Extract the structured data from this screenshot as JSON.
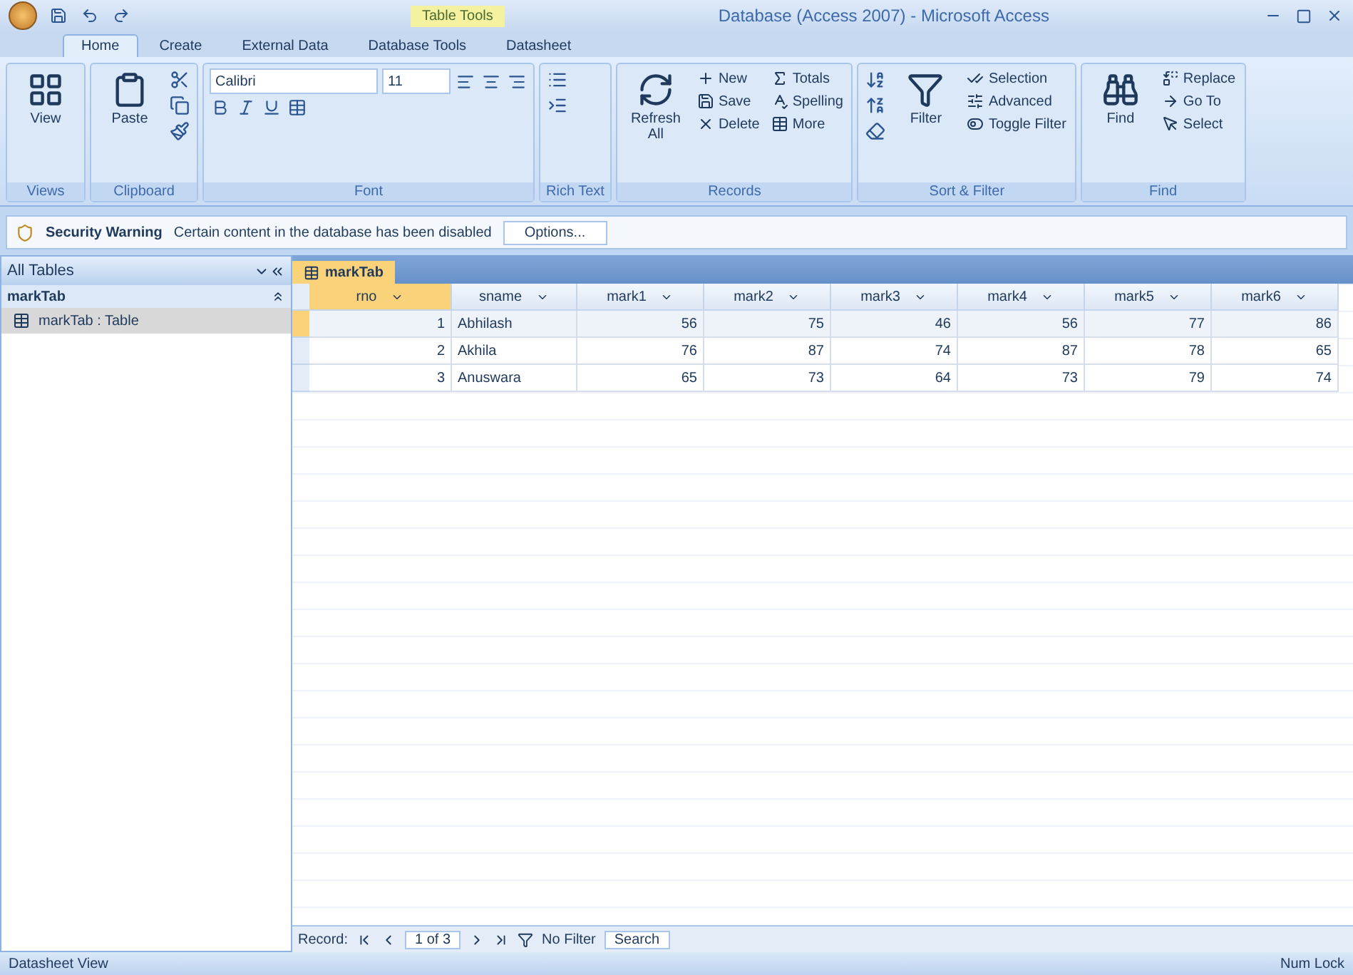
{
  "window": {
    "title": "Database (Access 2007) - Microsoft Access",
    "context_tab": "Table Tools"
  },
  "tabs": [
    {
      "label": "Home",
      "selected": true
    },
    {
      "label": "Create",
      "selected": false
    },
    {
      "label": "External Data",
      "selected": false
    },
    {
      "label": "Database Tools",
      "selected": false
    },
    {
      "label": "Datasheet",
      "selected": false
    }
  ],
  "ribbon": [
    {
      "label": "Views",
      "items": [
        {
          "kind": "large",
          "label": "View"
        }
      ]
    },
    {
      "label": "Clipboard",
      "items": [
        {
          "kind": "large",
          "label": "Paste"
        },
        {
          "kind": "clipboard_tools"
        }
      ]
    },
    {
      "label": "Font",
      "items": [
        {
          "kind": "font",
          "font": "Calibri",
          "size": "11"
        }
      ]
    },
    {
      "label": "Rich Text",
      "items": [
        {
          "kind": "richtext_tools"
        }
      ]
    },
    {
      "label": "Records",
      "items": [
        {
          "kind": "large",
          "label": "Refresh All"
        },
        {
          "kind": "small",
          "entries": [
            "New",
            "Save",
            "Delete"
          ]
        },
        {
          "kind": "small",
          "entries": [
            "Totals",
            "Spelling",
            "More"
          ]
        }
      ]
    },
    {
      "label": "Sort & Filter",
      "items": [
        {
          "kind": "sort_tools"
        },
        {
          "kind": "large",
          "label": "Filter"
        },
        {
          "kind": "small",
          "entries": [
            "Selection",
            "Advanced",
            "Toggle Filter"
          ]
        }
      ]
    },
    {
      "label": "Find",
      "items": [
        {
          "kind": "large",
          "label": "Find"
        },
        {
          "kind": "small",
          "entries": [
            "Replace",
            "Go To",
            "Select"
          ]
        }
      ]
    }
  ],
  "message_bar": {
    "title": "Security Warning",
    "text": "Certain content in the database has been disabled",
    "button": "Options..."
  },
  "nav_pane": {
    "header": "All Tables",
    "groups": [
      {
        "label": "markTab",
        "items": [
          {
            "label": "markTab : Table",
            "selected": true
          }
        ]
      }
    ]
  },
  "document_tab": "markTab",
  "table": {
    "columns": [
      "rno",
      "sname",
      "mark1",
      "mark2",
      "mark3",
      "mark4",
      "mark5",
      "mark6"
    ],
    "rows": [
      {
        "selected": true,
        "cells": [
          "1",
          "Abhilash",
          "56",
          "75",
          "46",
          "56",
          "77",
          "86"
        ]
      },
      {
        "selected": false,
        "cells": [
          "2",
          "Akhila",
          "76",
          "87",
          "74",
          "87",
          "78",
          "65"
        ]
      },
      {
        "selected": false,
        "cells": [
          "3",
          "Anuswara",
          "65",
          "73",
          "64",
          "73",
          "79",
          "74"
        ]
      }
    ]
  },
  "record_nav": {
    "label": "Record:",
    "position": "1 of 3",
    "filter": "No Filter",
    "search": "Search"
  },
  "status_bar": {
    "left": "Datasheet View",
    "right": "Num Lock"
  }
}
